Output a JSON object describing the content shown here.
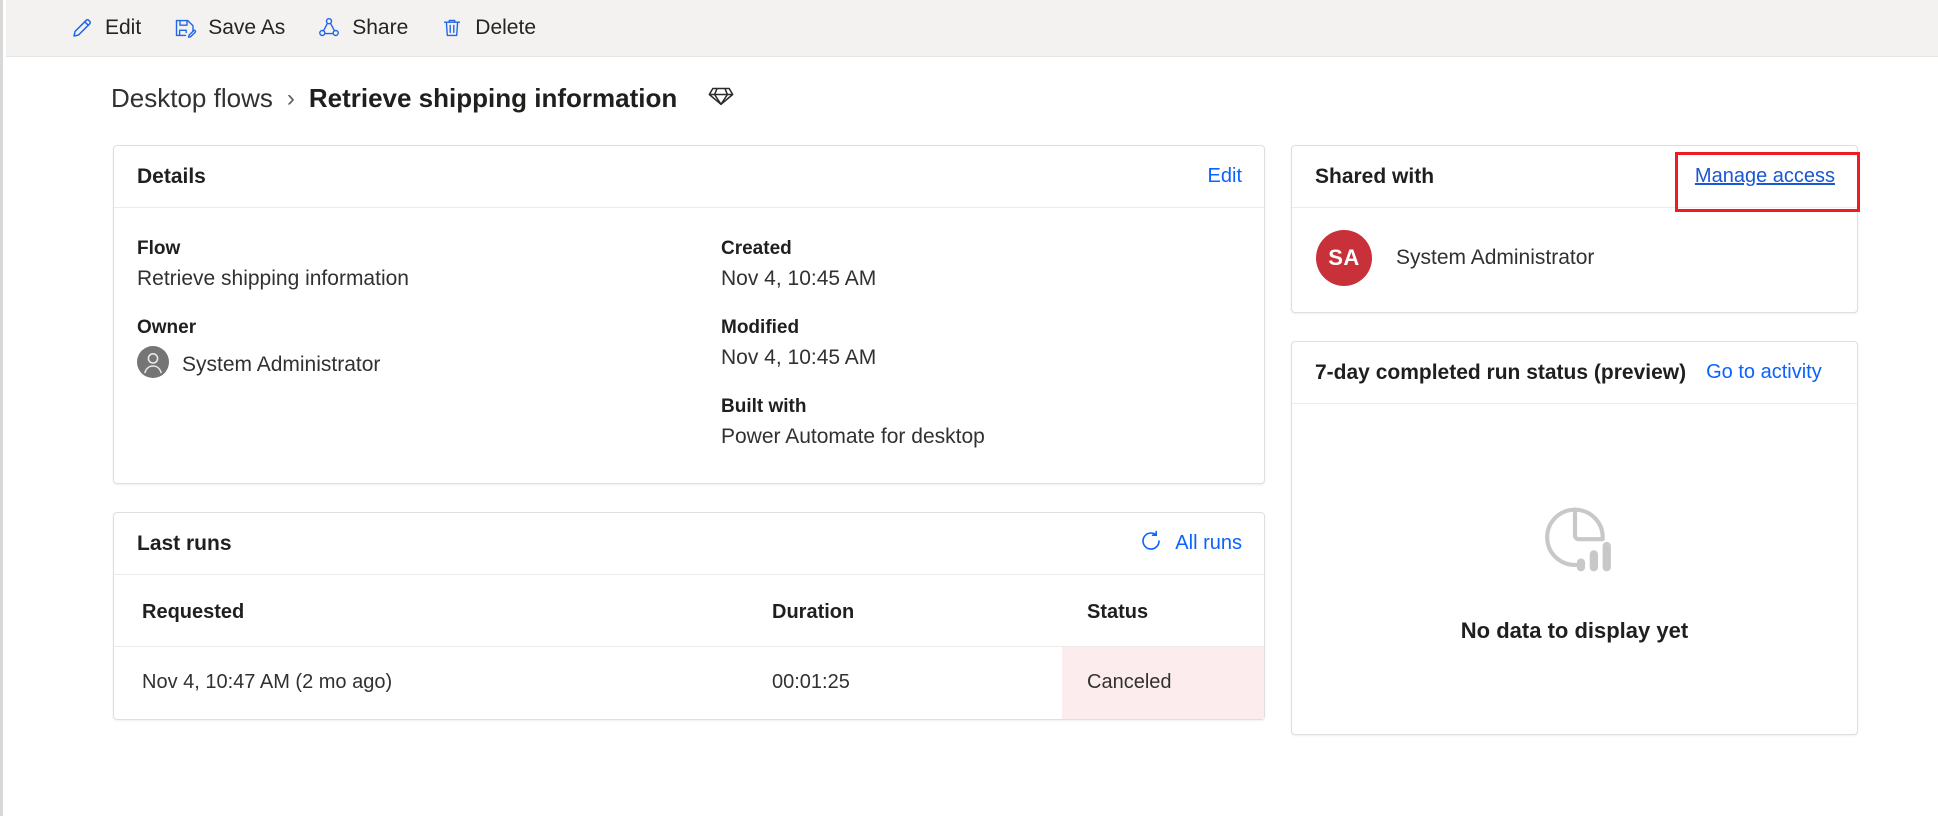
{
  "toolbar": {
    "items": [
      {
        "label": "Edit",
        "icon": "pencil-icon",
        "name": "edit"
      },
      {
        "label": "Save As",
        "icon": "save-as-icon",
        "name": "save-as"
      },
      {
        "label": "Share",
        "icon": "share-icon",
        "name": "share"
      },
      {
        "label": "Delete",
        "icon": "trash-icon",
        "name": "delete"
      }
    ]
  },
  "breadcrumb": {
    "parent": "Desktop flows",
    "separator": "›",
    "current": "Retrieve shipping information",
    "badge_icon": "gem-icon"
  },
  "details": {
    "title": "Details",
    "edit_link": "Edit",
    "fields": {
      "flow_label": "Flow",
      "flow_value": "Retrieve shipping information",
      "owner_label": "Owner",
      "owner_value": "System Administrator",
      "created_label": "Created",
      "created_value": "Nov 4, 10:45 AM",
      "modified_label": "Modified",
      "modified_value": "Nov 4, 10:45 AM",
      "built_with_label": "Built with",
      "built_with_value": "Power Automate for desktop"
    }
  },
  "last_runs": {
    "title": "Last runs",
    "all_runs_link": "All runs",
    "refresh_icon": "refresh-icon",
    "columns": [
      "Requested",
      "Duration",
      "Status"
    ],
    "rows": [
      {
        "requested": "Nov 4, 10:47 AM (2 mo ago)",
        "duration": "00:01:25",
        "status": "Canceled"
      }
    ]
  },
  "shared_with": {
    "title": "Shared with",
    "manage_access_link": "Manage access",
    "people": [
      {
        "initials": "SA",
        "name": "System Administrator"
      }
    ]
  },
  "run_status": {
    "title": "7-day completed run status (preview)",
    "activity_link": "Go to activity",
    "empty_icon": "pie-bar-chart-icon",
    "empty_text": "No data to display yet"
  },
  "colors": {
    "link_blue": "#1367d8",
    "bright_blue": "#0a62ff",
    "highlight_red": "#ed1c24",
    "avatar_red": "#c8313a",
    "status_canceled_bg": "#fdecee",
    "toolbar_bg": "#f3f2f1"
  }
}
